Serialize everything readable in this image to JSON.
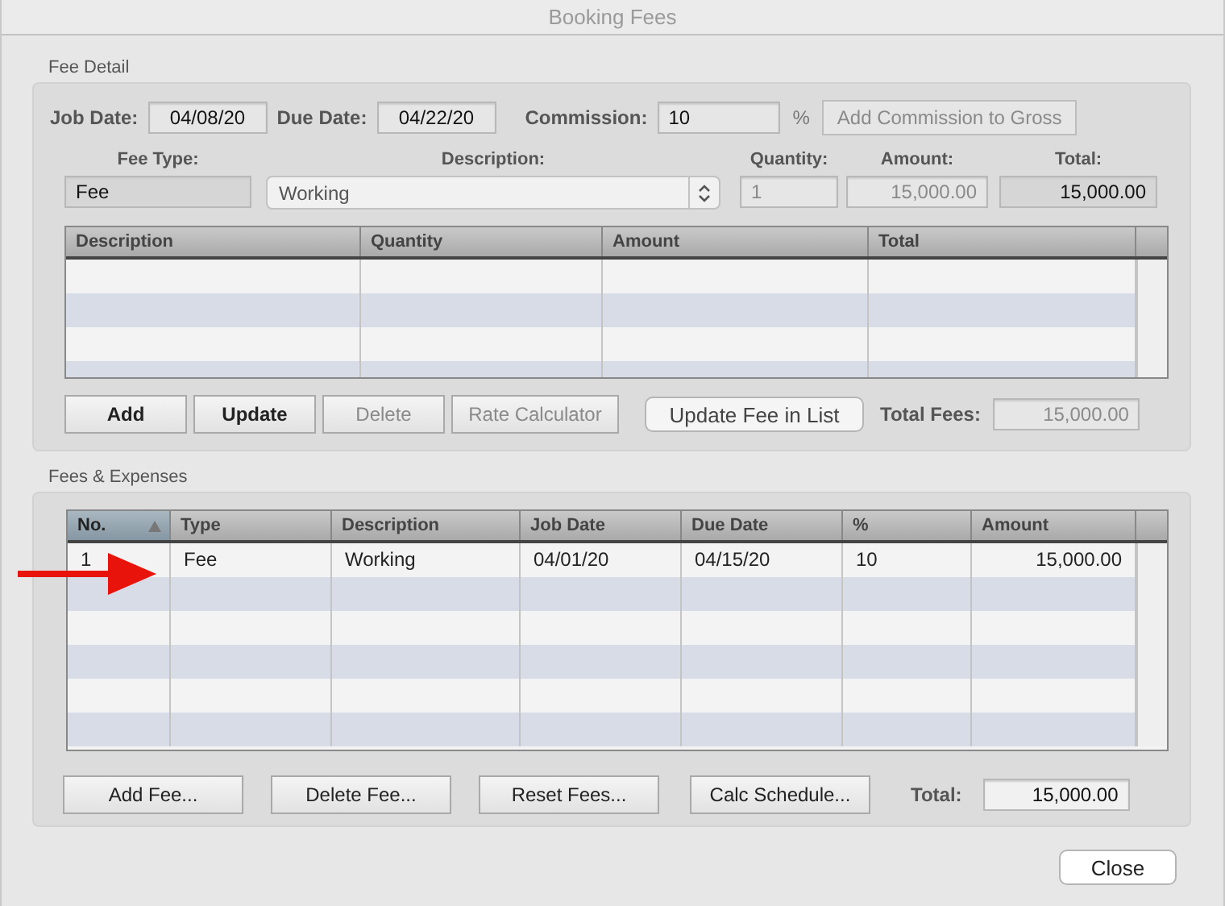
{
  "window": {
    "title": "Booking Fees"
  },
  "fee_detail": {
    "title": "Fee Detail",
    "job_date": {
      "label": "Job Date:",
      "value": "04/08/20"
    },
    "due_date": {
      "label": "Due Date:",
      "value": "04/22/20"
    },
    "commission": {
      "label": "Commission:",
      "value": "10",
      "unit": "%"
    },
    "add_commission_button": {
      "label": "Add Commission to Gross",
      "disabled": true
    },
    "fee_type": {
      "label": "Fee Type:",
      "value": "Fee"
    },
    "description": {
      "label": "Description:",
      "value": "Working"
    },
    "quantity": {
      "label": "Quantity:",
      "value": "1",
      "disabled": true
    },
    "amount": {
      "label": "Amount:",
      "value": "15,000.00",
      "disabled": true
    },
    "total": {
      "label": "Total:",
      "value": "15,000.00",
      "disabled": false
    },
    "table": {
      "columns": [
        "Description",
        "Quantity",
        "Amount",
        "Total"
      ]
    },
    "buttons": [
      {
        "label": "Add",
        "disabled": false
      },
      {
        "label": "Update",
        "disabled": false
      },
      {
        "label": "Delete",
        "disabled": true
      },
      {
        "label": "Rate Calculator",
        "disabled": true
      }
    ],
    "update_fee_button": {
      "label": "Update Fee in List"
    },
    "total_fees": {
      "label": "Total Fees:",
      "value": "15,000.00",
      "disabled": true
    }
  },
  "fees_expenses": {
    "title": "Fees & Expenses",
    "table": {
      "columns": [
        {
          "label": "No.",
          "sorted": true
        },
        {
          "label": "Type",
          "sorted": false
        },
        {
          "label": "Description",
          "sorted": false
        },
        {
          "label": "Job Date",
          "sorted": false
        },
        {
          "label": "Due Date",
          "sorted": false
        },
        {
          "label": "%",
          "sorted": false
        },
        {
          "label": "Amount",
          "sorted": false
        }
      ],
      "rows": [
        [
          "1",
          "Fee",
          "Working",
          "04/01/20",
          "04/15/20",
          "10",
          "15,000.00"
        ]
      ]
    },
    "buttons": [
      "Add Fee...",
      "Delete Fee...",
      "Reset Fees...",
      "Calc Schedule..."
    ],
    "total": {
      "label": "Total:",
      "value": "15,000.00"
    }
  },
  "close_button": "Close"
}
